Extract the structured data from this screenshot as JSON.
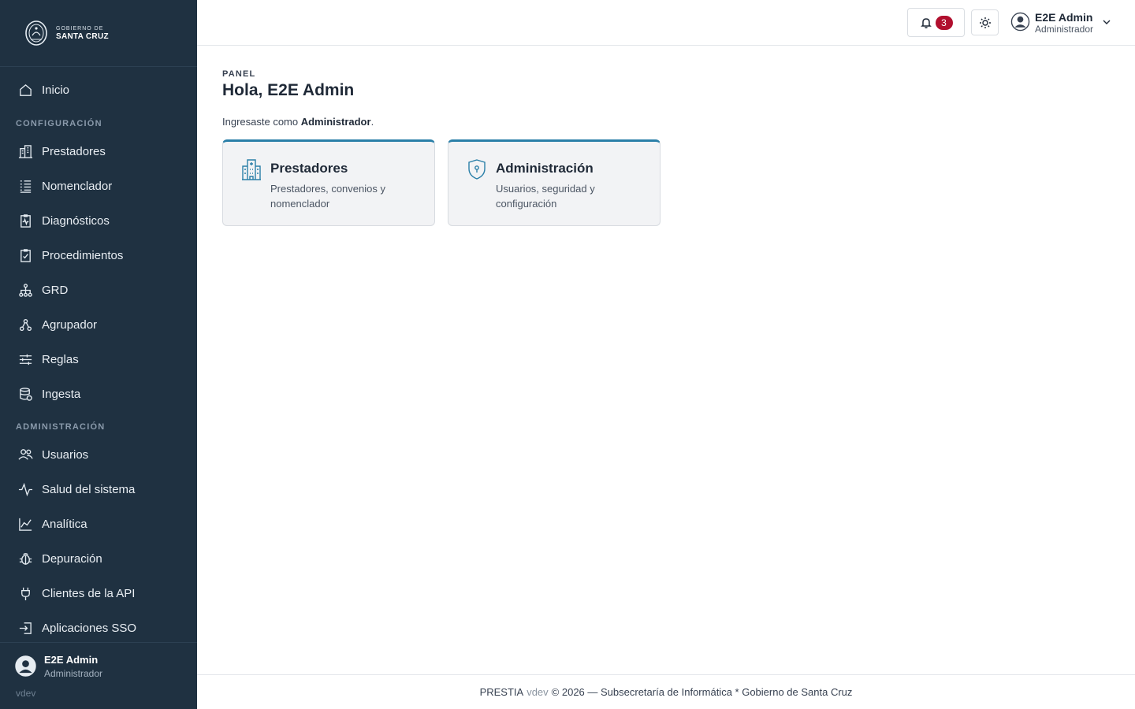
{
  "brand": {
    "line1": "GOBIERNO DE",
    "line2": "SANTA CRUZ"
  },
  "sidebar": {
    "home": {
      "label": "Inicio",
      "icon": "home-icon"
    },
    "section_config": "CONFIGURACIÓN",
    "config_items": [
      {
        "label": "Prestadores",
        "icon": "building-icon"
      },
      {
        "label": "Nomenclador",
        "icon": "list-icon"
      },
      {
        "label": "Diagnósticos",
        "icon": "clipboard-pulse-icon"
      },
      {
        "label": "Procedimientos",
        "icon": "clipboard-check-icon"
      },
      {
        "label": "GRD",
        "icon": "hierarchy-icon"
      },
      {
        "label": "Agrupador",
        "icon": "group-icon"
      },
      {
        "label": "Reglas",
        "icon": "sliders-icon"
      },
      {
        "label": "Ingesta",
        "icon": "database-icon"
      }
    ],
    "section_admin": "ADMINISTRACIÓN",
    "admin_items": [
      {
        "label": "Usuarios",
        "icon": "users-icon"
      },
      {
        "label": "Salud del sistema",
        "icon": "activity-icon"
      },
      {
        "label": "Analítica",
        "icon": "chart-line-icon"
      },
      {
        "label": "Depuración",
        "icon": "bug-icon"
      },
      {
        "label": "Clientes de la API",
        "icon": "plug-icon"
      },
      {
        "label": "Aplicaciones SSO",
        "icon": "sign-in-icon"
      }
    ],
    "user": {
      "name": "E2E Admin",
      "role": "Administrador"
    },
    "version": "vdev"
  },
  "topbar": {
    "notifications_count": "3",
    "user": {
      "name": "E2E Admin",
      "role": "Administrador"
    }
  },
  "main": {
    "eyebrow": "PANEL",
    "title": "Hola, E2E Admin",
    "intro_prefix": "Ingresaste como ",
    "intro_role": "Administrador",
    "intro_suffix": ".",
    "cards": [
      {
        "title": "Prestadores",
        "description": "Prestadores, convenios y nomenclador",
        "icon": "hospital-icon"
      },
      {
        "title": "Administración",
        "description": "Usuarios, seguridad y configuración",
        "icon": "shield-lock-icon"
      }
    ]
  },
  "footer": {
    "app": "PRESTIA",
    "version": "vdev",
    "rest": "© 2026 — Subsecretaría de Informática * Gobierno de Santa Cruz"
  },
  "colors": {
    "sidebar_bg": "#1f3141",
    "accent": "#2a7fa8",
    "badge": "#b10f2e"
  }
}
